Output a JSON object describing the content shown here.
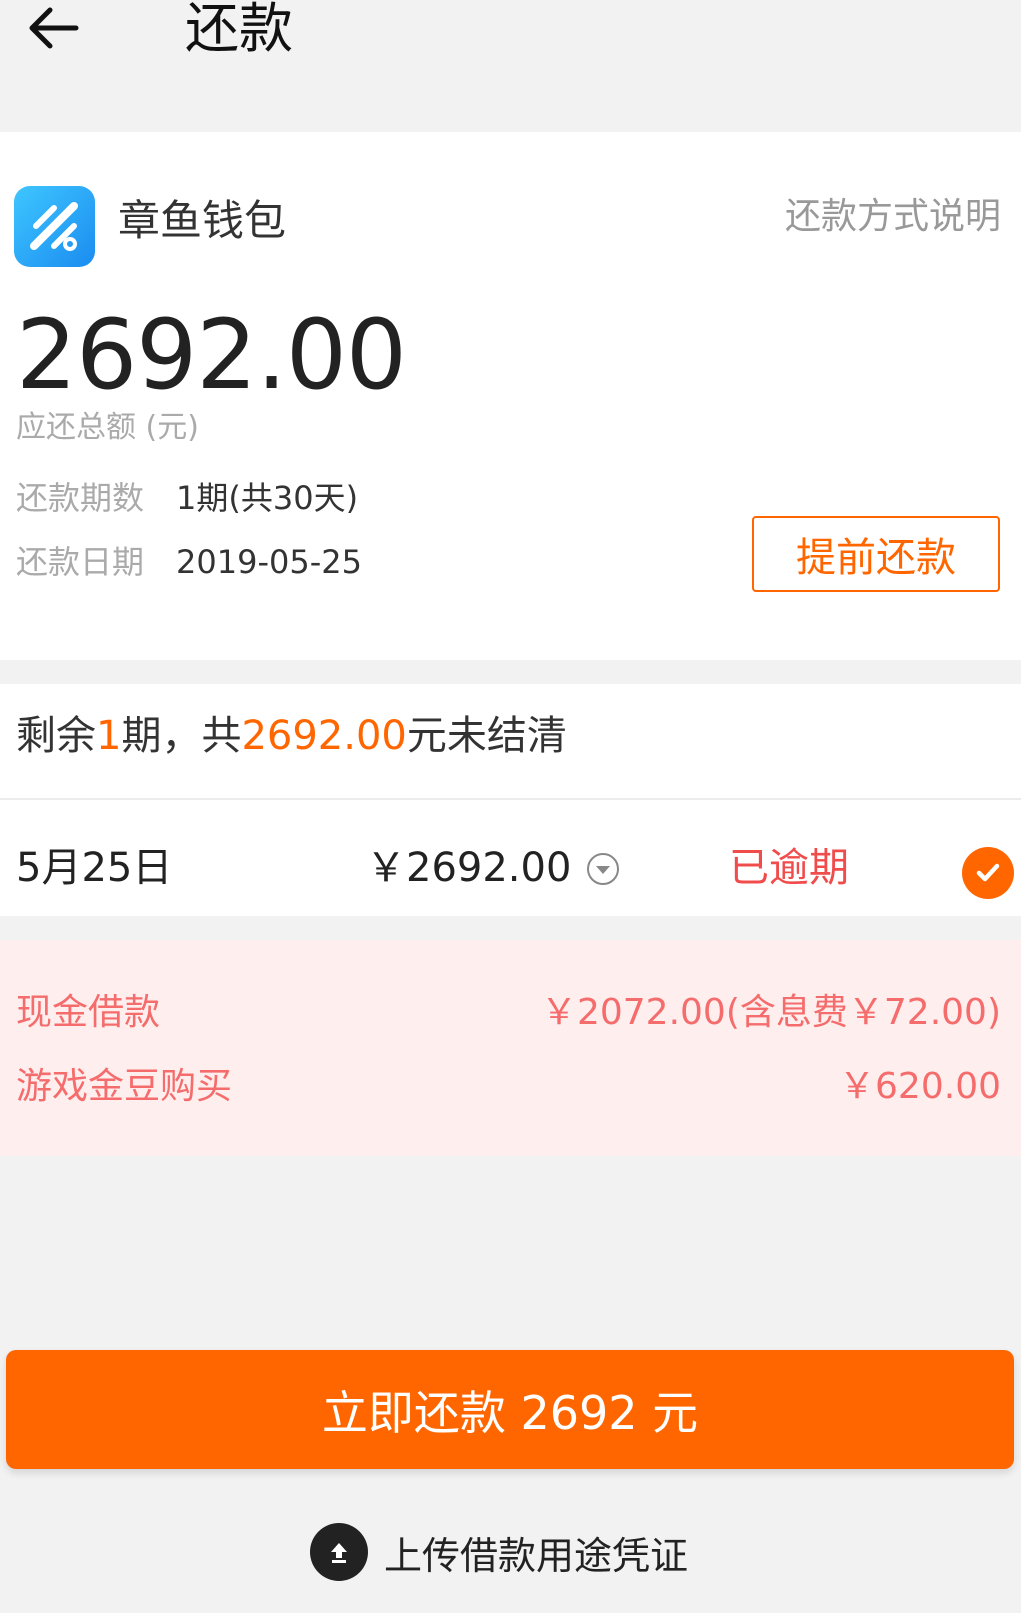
{
  "header": {
    "title": "还款",
    "back_icon": "arrow-left-icon"
  },
  "account": {
    "app_name": "章鱼钱包",
    "method_link": "还款方式说明",
    "total_amount": "2692.00",
    "total_label": "应还总额 (元)",
    "period_key": "还款期数",
    "period_value": "1期(共30天)",
    "date_key": "还款日期",
    "date_value": "2019-05-25",
    "early_repay_label": "提前还款"
  },
  "installments": {
    "summary_prefix": "剩余",
    "remaining_periods": "1",
    "summary_mid": "期，共",
    "remaining_amount": "2692.00",
    "summary_suffix": "元未结清",
    "rows": [
      {
        "date": "5月25日",
        "amount": "￥2692.00",
        "status": "已逾期",
        "selected": true
      }
    ]
  },
  "breakdown": [
    {
      "label": "现金借款",
      "value": "￥2072.00(含息费￥72.00)"
    },
    {
      "label": "游戏金豆购买",
      "value": "￥620.00"
    }
  ],
  "actions": {
    "pay_now_label": "立即还款 2692 元",
    "upload_label": "上传借款用途凭证"
  },
  "colors": {
    "accent": "#ff6600",
    "overdue": "#f04c4c",
    "breakdown_text": "#f56c6c",
    "breakdown_bg": "#ffeeee",
    "logo": "#1a8cf0"
  }
}
